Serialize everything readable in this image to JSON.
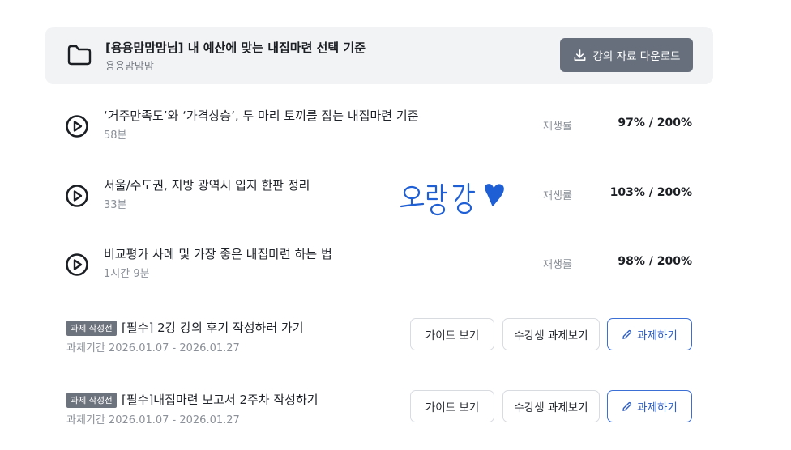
{
  "header": {
    "title": "[용용맘맘맘님] 내 예산에 맞는 내집마련 선택 기준",
    "author": "용용맘맘맘",
    "download_label": "강의 자료 다운로드",
    "folder_icon": "folder-icon",
    "download_icon": "download-icon"
  },
  "lectures": [
    {
      "title": "‘거주만족도’와 ‘가격상승’, 두 마리 토끼를 잡는 내집마련 기준",
      "duration": "58분",
      "rate_label": "재생률",
      "rate": "97% / 200%"
    },
    {
      "title": "서울/수도권, 지방 광역시 입지 한판 정리",
      "duration": "33분",
      "rate_label": "재생률",
      "rate": "103% / 200%"
    },
    {
      "title": "비교평가 사례 및 가장 좋은 내집마련 하는 법",
      "duration": "1시간 9분",
      "rate_label": "재생률",
      "rate": "98% / 200%"
    }
  ],
  "assignments": [
    {
      "badge": "과제 작성전",
      "title": "[필수] 2강 강의 후기 작성하러 가기",
      "period": "과제기간 2026.01.07 - 2026.01.27",
      "guide_label": "가이드 보기",
      "peer_label": "수강생 과제보기",
      "task_label": "과제하기"
    },
    {
      "badge": "과제 작성전",
      "title": "[필수]내집마련 보고서 2주차 작성하기",
      "period": "과제기간 2026.01.07 - 2026.01.27",
      "guide_label": "가이드 보기",
      "peer_label": "수강생 과제보기",
      "task_label": "과제하기"
    }
  ],
  "handwriting": {
    "text": "오랑강",
    "color": "#1f5fd6"
  }
}
